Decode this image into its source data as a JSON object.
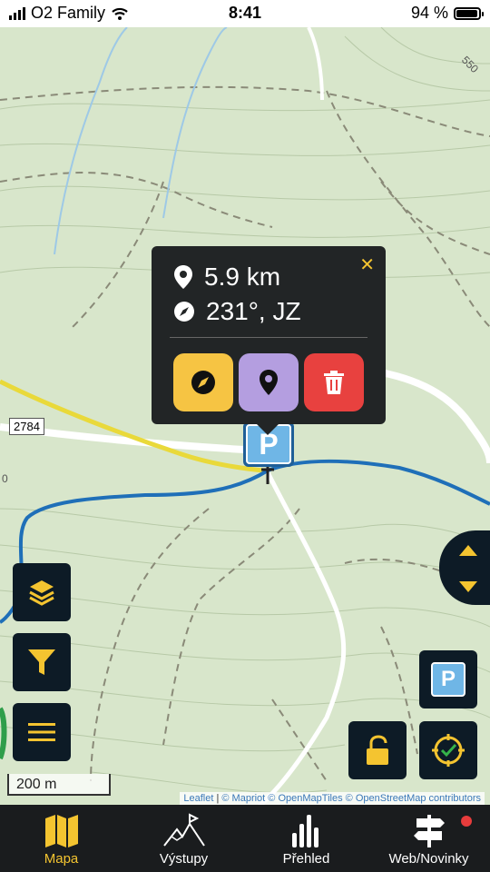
{
  "status_bar": {
    "carrier": "O2 Family",
    "time": "8:41",
    "battery": "94 %"
  },
  "popup": {
    "distance": "5.9 km",
    "bearing": "231°, JZ",
    "close_icon": "close-icon",
    "actions": [
      {
        "icon": "compass-icon",
        "color": "#f6c443"
      },
      {
        "icon": "map-pin-icon",
        "color": "#b49ee0"
      },
      {
        "icon": "trash-icon",
        "color": "#e8413f"
      }
    ]
  },
  "map": {
    "road_label": "2784",
    "contour_label_top": "550",
    "contour_label_left": "0",
    "scale": "200 m",
    "parking_marker": "P",
    "attribution": {
      "leaflet": "Leaflet",
      "sep": "|",
      "mapriot": "© Mapriot",
      "openmaptiles": "© OpenMapTiles",
      "osm": "© OpenStreetMap contributors"
    }
  },
  "map_buttons": {
    "layers": "layers-icon",
    "filter": "filter-icon",
    "menu": "menu-icon",
    "parking": "P",
    "lock": "unlock-icon",
    "locate": "locate-icon",
    "up_down": "up-down-arrows-icon"
  },
  "bottom_nav": [
    {
      "label": "Mapa",
      "icon": "map-icon",
      "active": true
    },
    {
      "label": "Výstupy",
      "icon": "mountain-flag-icon",
      "active": false
    },
    {
      "label": "Přehled",
      "icon": "bar-chart-icon",
      "active": false
    },
    {
      "label": "Web/Novinky",
      "icon": "signpost-icon",
      "active": false
    }
  ],
  "colors": {
    "accent": "#f4c430",
    "nav_bg": "#1a1c1e",
    "button_bg": "#0d1b26",
    "map_bg": "#d9e7cc",
    "trail_blue": "#1f6fb8",
    "road_yellow": "#e9d93a"
  }
}
